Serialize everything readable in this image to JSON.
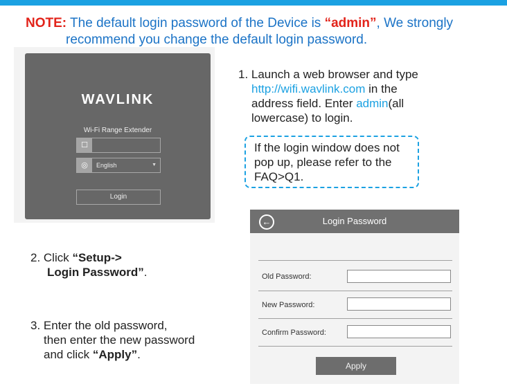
{
  "note": {
    "label": "NOTE:",
    "text_part1": " The default login password of the Device is ",
    "highlight": "“admin”",
    "text_part2": ", We  strongly",
    "line2": "recommend you change the default login password."
  },
  "login_screen": {
    "brand": "WAVLINK",
    "subtitle": "Wi-Fi Range Extender",
    "language": "English",
    "login_button": "Login"
  },
  "step1": {
    "prefix": "1. Launch a web browser and type",
    "url": "http://wifi.wavlink.com",
    "text_after_url": " in the",
    "line3": "address field. Enter ",
    "user": "admin",
    "after_user": "(all",
    "line4": "lowercase) to login."
  },
  "faq": {
    "line1": "If the login window does not",
    "line2": "pop up, please refer to the",
    "line3": "FAQ>Q1."
  },
  "step2": {
    "prefix": "2. Click ",
    "bold1": "“Setup->",
    "bold2": "Login Password”",
    "suffix": "."
  },
  "step3": {
    "line1": "3. Enter the old password,",
    "line2": "then enter the new password",
    "line3_prefix": "and click ",
    "bold": "“Apply”",
    "suffix": "."
  },
  "password_panel": {
    "title": "Login Password",
    "old_label": "Old Password:",
    "new_label": "New Password:",
    "confirm_label": "Confirm Password:",
    "apply_button": "Apply"
  },
  "colors": {
    "accent_blue": "#1ba1e2",
    "note_red": "#e2231a",
    "note_blue": "#1b73c6"
  }
}
